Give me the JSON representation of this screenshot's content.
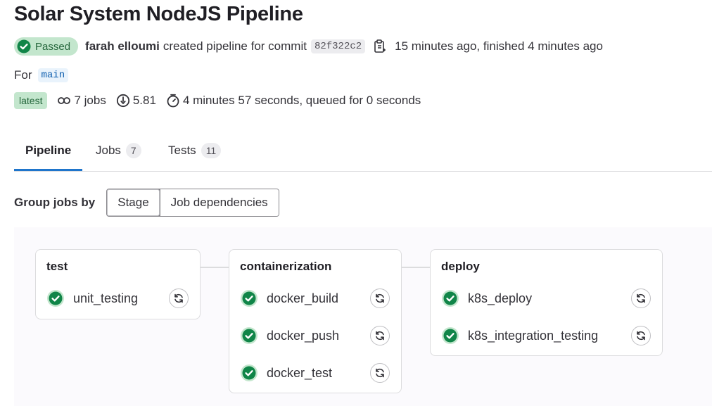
{
  "header": {
    "title": "Solar System NodeJS Pipeline",
    "status_badge": "Passed",
    "author": "farah elloumi",
    "action_text": "created pipeline for commit",
    "commit_sha": "82f322c2",
    "time_text": "15 minutes ago, finished 4 minutes ago",
    "for_label": "For",
    "branch": "main",
    "latest_badge": "latest",
    "jobs_count": "7 jobs",
    "compute_minutes": "5.81",
    "duration": "4 minutes 57 seconds, queued for 0 seconds"
  },
  "tabs": [
    {
      "label": "Pipeline",
      "count": null,
      "active": true
    },
    {
      "label": "Jobs",
      "count": "7",
      "active": false
    },
    {
      "label": "Tests",
      "count": "11",
      "active": false
    }
  ],
  "group_by": {
    "label": "Group jobs by",
    "options": [
      "Stage",
      "Job dependencies"
    ],
    "selected": "Stage"
  },
  "stages": [
    {
      "name": "test",
      "jobs": [
        {
          "name": "unit_testing",
          "status": "passed"
        }
      ]
    },
    {
      "name": "containerization",
      "jobs": [
        {
          "name": "docker_build",
          "status": "passed"
        },
        {
          "name": "docker_push",
          "status": "passed"
        },
        {
          "name": "docker_test",
          "status": "passed"
        }
      ]
    },
    {
      "name": "deploy",
      "jobs": [
        {
          "name": "k8s_deploy",
          "status": "passed"
        },
        {
          "name": "k8s_integration_testing",
          "status": "passed"
        }
      ]
    }
  ],
  "colors": {
    "success": "#108548",
    "success_bg": "#c3e6cd",
    "tab_active": "#1f75cb",
    "branch_text": "#0b5cad"
  },
  "icons": {
    "status": "check-circle-icon",
    "copy": "copy-icon",
    "pipeline": "pipeline-icon",
    "compute": "compute-icon",
    "timer": "timer-icon",
    "retry": "retry-icon"
  }
}
